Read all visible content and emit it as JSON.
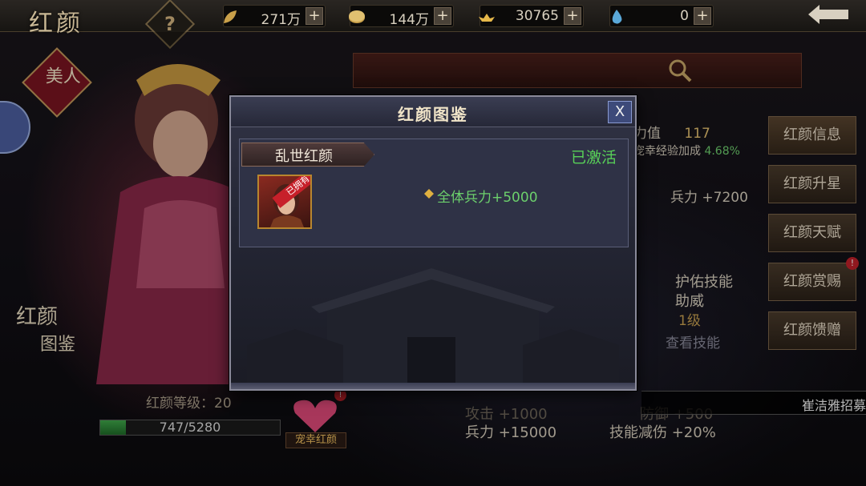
{
  "header": {
    "screen_title": "红颜",
    "help_icon": "question-icon",
    "resources": [
      {
        "icon": "leaf-icon",
        "value": "271万"
      },
      {
        "icon": "coin-icon",
        "value": "144万"
      },
      {
        "icon": "ingot-icon",
        "value": "30765"
      },
      {
        "icon": "drop-icon",
        "value": "0"
      }
    ],
    "plus_label": "+"
  },
  "left": {
    "badge_text": "美人",
    "codex_line1": "红颜",
    "codex_line2": "图鉴"
  },
  "side_menu": [
    {
      "label": "红颜信息",
      "badge": ""
    },
    {
      "label": "红颜升星",
      "badge": ""
    },
    {
      "label": "红颜天赋",
      "badge": ""
    },
    {
      "label": "红颜赏赐",
      "badge": "!"
    },
    {
      "label": "红颜馈赠",
      "badge": ""
    }
  ],
  "info_panel": {
    "charm_value": "力值",
    "charm_number": "117",
    "exp_bonus_label": "宠幸经验加成",
    "exp_bonus_value": "4.68%",
    "troop_bonus": "兵力 +7200",
    "skill_title": "护佑技能",
    "skill_name": "助威",
    "skill_level": "1级",
    "skill_view": "查看技能"
  },
  "bottom": {
    "level_label": "红颜等级：20",
    "xp_text": "747/5280",
    "xp_fraction": 0.1415,
    "favor_label": "宠幸红颜",
    "favor_badge": "!",
    "stat_attack_faded": "攻击 +1000",
    "stat_defense_faded": "防御 +500",
    "stat_troops": "兵力 +15000",
    "stat_skill_dmg": "技能减伤 +20%",
    "marquee_text": "崔洁雅招募"
  },
  "modal": {
    "title": "红颜图鉴",
    "close_label": "X",
    "entry": {
      "name": "乱世红颜",
      "status": "已激活",
      "owned_ribbon": "已拥有",
      "bonus_text": "全体兵力+5000"
    }
  },
  "colors": {
    "active_green": "#58d058",
    "bonus_green": "#6cd06c",
    "modal_bg": "#2a2c3a",
    "close_blue": "#3d4a7a"
  }
}
